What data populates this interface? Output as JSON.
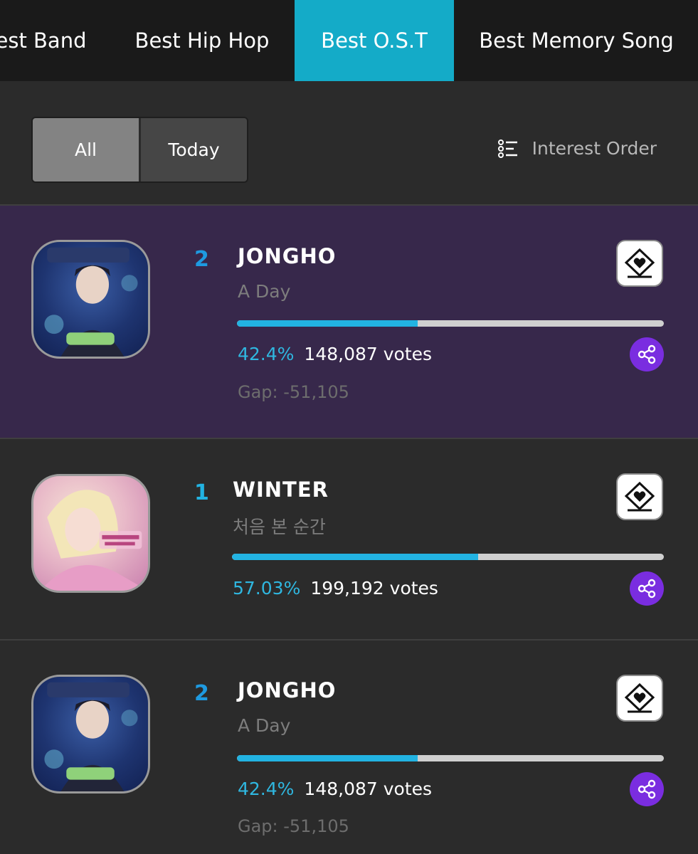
{
  "tabs": [
    {
      "label": "est Band",
      "active": false
    },
    {
      "label": "Best Hip Hop",
      "active": false
    },
    {
      "label": "Best O.S.T",
      "active": true
    },
    {
      "label": "Best Memory Song",
      "active": false
    }
  ],
  "filter": {
    "all_label": "All",
    "today_label": "Today",
    "order_label": "Interest Order"
  },
  "entries": [
    {
      "rank": "2",
      "artist": "JONGHO",
      "song": "A Day",
      "progress": 0.424,
      "percent": "42.4%",
      "votes": "148,087 votes",
      "gap": "Gap: -51,105",
      "highlighted": true,
      "thumb_icon": "album-art-a-day-icon"
    },
    {
      "rank": "1",
      "artist": "WINTER",
      "song": "처음 본 순간",
      "progress": 0.5703,
      "percent": "57.03%",
      "votes": "199,192 votes",
      "gap": "",
      "highlighted": false,
      "thumb_icon": "album-art-winter-icon"
    },
    {
      "rank": "2",
      "artist": "JONGHO",
      "song": "A Day",
      "progress": 0.424,
      "percent": "42.4%",
      "votes": "148,087 votes",
      "gap": "Gap: -51,105",
      "highlighted": false,
      "thumb_icon": "album-art-a-day-icon"
    }
  ],
  "colors": {
    "accent": "#14abc8",
    "progress_fill": "#22b3e2",
    "highlight_row": "#37284b",
    "share_button": "#7a2de0",
    "rank": "#1e9ae0"
  }
}
